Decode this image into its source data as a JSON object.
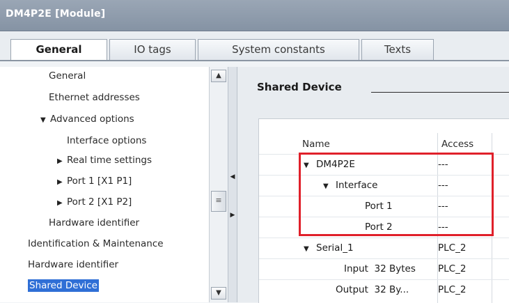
{
  "window": {
    "title": "DM4P2E [Module]"
  },
  "tabs": [
    {
      "label": "General",
      "active": true
    },
    {
      "label": "IO tags",
      "active": false
    },
    {
      "label": "System constants",
      "active": false
    },
    {
      "label": "Texts",
      "active": false
    }
  ],
  "nav": {
    "items": [
      {
        "label": "General",
        "expander": ""
      },
      {
        "label": "Ethernet addresses",
        "expander": ""
      },
      {
        "label": "Advanced options",
        "expander": "▼"
      },
      {
        "label": "Interface options",
        "expander": ""
      },
      {
        "label": "Real time settings",
        "expander": "▶"
      },
      {
        "label": "Port 1 [X1 P1]",
        "expander": "▶"
      },
      {
        "label": "Port 2 [X1 P2]",
        "expander": "▶"
      },
      {
        "label": "Hardware identifier",
        "expander": ""
      },
      {
        "label": "Identification & Maintenance",
        "expander": ""
      },
      {
        "label": "Hardware identifier",
        "expander": ""
      },
      {
        "label": "Shared Device",
        "expander": "",
        "selected": true
      }
    ]
  },
  "content": {
    "section_title": "Shared Device",
    "table": {
      "headers": {
        "name": "Name",
        "access": "Access"
      },
      "rows": [
        {
          "name": "DM4P2E",
          "access": "---",
          "expander": "▼"
        },
        {
          "name": "Interface",
          "access": "---",
          "expander": "▼"
        },
        {
          "name": "Port 1",
          "access": "---",
          "expander": ""
        },
        {
          "name": "Port 2",
          "access": "---",
          "expander": ""
        },
        {
          "name": "Serial_1",
          "access": "PLC_2",
          "expander": "▼"
        },
        {
          "name": "Input  32 Bytes",
          "access": "PLC_2",
          "expander": ""
        },
        {
          "name": "Output  32 By...",
          "access": "PLC_2",
          "expander": ""
        }
      ]
    }
  },
  "colors": {
    "highlight": "#e0202a",
    "selection": "#2f6fd6",
    "titlebar": "#8d9aab"
  },
  "icons": {
    "scroll_up": "chevron-up-icon",
    "scroll_down": "chevron-down-icon",
    "collapse": "triangle-left-icon",
    "expand": "triangle-right-icon"
  }
}
